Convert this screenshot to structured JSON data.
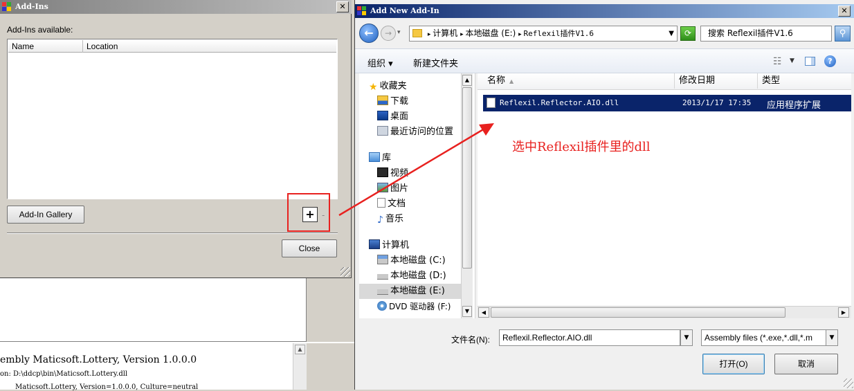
{
  "addins_dialog": {
    "title": "Add-Ins",
    "available_label": "Add-Ins available:",
    "columns": [
      "Name",
      "Location"
    ],
    "gallery_button": "Add-In Gallery",
    "add_button_glyph": "+",
    "close_button": "Close"
  },
  "background_window": {
    "assembly_line": "embly Maticsoft.Lottery, Version 1.0.0.0",
    "location_line": "on: D:\\ddcp\\bin\\Maticsoft.Lottery.dll",
    "fullname_line": "Maticsoft.Lottery, Version=1.0.0.0, Culture=neutral"
  },
  "file_dialog": {
    "title": "Add New Add-In",
    "breadcrumb": [
      "计算机",
      "本地磁盘 (E:)",
      "Reflexil插件V1.6"
    ],
    "search_placeholder": "搜索 Reflexil插件V1.6",
    "toolbar": {
      "organize": "组织 ▾",
      "new_folder": "新建文件夹"
    },
    "nav": {
      "favorites": "收藏夹",
      "downloads": "下载",
      "desktop": "桌面",
      "recent": "最近访问的位置",
      "libraries": "库",
      "videos": "视频",
      "pictures": "图片",
      "documents": "文档",
      "music": "音乐",
      "computer": "计算机",
      "drive_c": "本地磁盘 (C:)",
      "drive_d": "本地磁盘 (D:)",
      "drive_e": "本地磁盘 (E:)",
      "drive_f": "DVD 驱动器 (F:)"
    },
    "columns": {
      "name": "名称",
      "date": "修改日期",
      "type": "类型"
    },
    "files": [
      {
        "name": "Reflexil.Reflector.AIO.dll",
        "date": "2013/1/17 17:35",
        "type": "应用程序扩展"
      }
    ],
    "filename_label": "文件名(N):",
    "filename_value": "Reflexil.Reflector.AIO.dll",
    "filter_value": "Assembly files (*.exe,*.dll,*.m",
    "open_button": "打开(O)",
    "cancel_button": "取消"
  },
  "annotation": {
    "text": "选中Reflexil插件里的dll",
    "color": "#e8211f"
  }
}
